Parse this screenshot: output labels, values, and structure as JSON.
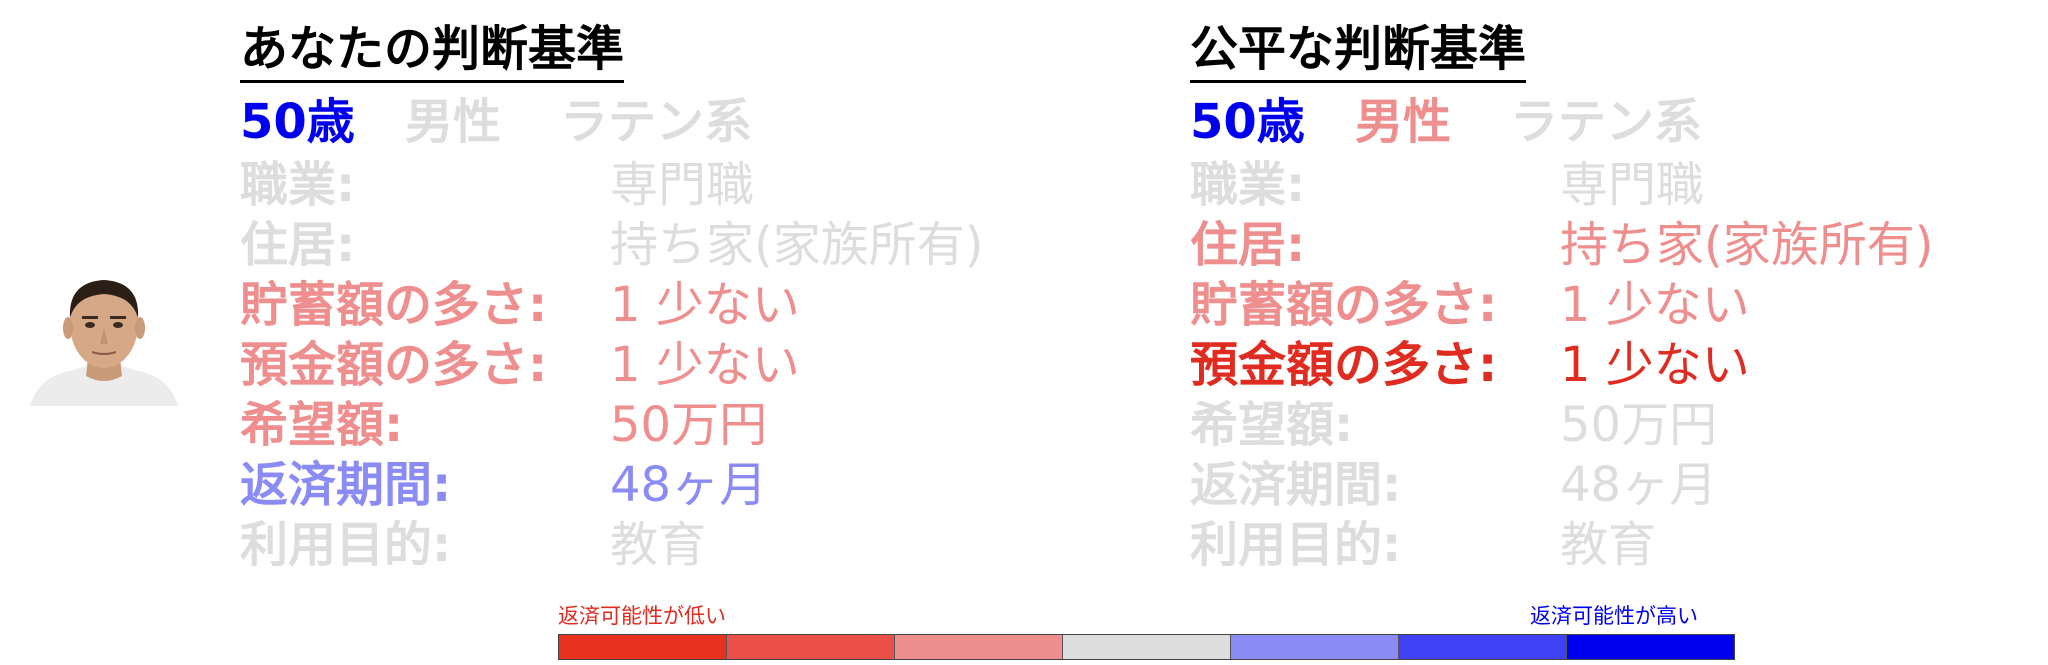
{
  "palette": {
    "neutral": "#dddddd",
    "red_light": "#ee8e8e",
    "red_strong": "#e02b20",
    "blue_light": "#8b8bf5",
    "blue_strong": "#0000ee"
  },
  "left": {
    "title": "あなたの判断基準",
    "age": {
      "text": "50歳",
      "color": "#0000ee"
    },
    "gender": {
      "text": "男性",
      "color": "#dddddd"
    },
    "ethnicity": {
      "text": "ラテン系",
      "color": "#dddddd"
    },
    "rows": [
      {
        "label": "職業:",
        "value": "専門職",
        "color": "#dddddd"
      },
      {
        "label": "住居:",
        "value": "持ち家(家族所有)",
        "color": "#dddddd"
      },
      {
        "label": "貯蓄額の多さ:",
        "value": "1 少ない",
        "color": "#ee8e8e"
      },
      {
        "label": "預金額の多さ:",
        "value": "1 少ない",
        "color": "#ee8e8e"
      },
      {
        "label": "希望額:",
        "value": "50万円",
        "color": "#ee8e8e"
      },
      {
        "label": "返済期間:",
        "value": "48ヶ月",
        "color": "#8b8bf5"
      },
      {
        "label": "利用目的:",
        "value": "教育",
        "color": "#dddddd"
      }
    ]
  },
  "right": {
    "title": "公平な判断基準",
    "age": {
      "text": "50歳",
      "color": "#0000ee"
    },
    "gender": {
      "text": "男性",
      "color": "#ee8e8e"
    },
    "ethnicity": {
      "text": "ラテン系",
      "color": "#dddddd"
    },
    "rows": [
      {
        "label": "職業:",
        "value": "専門職",
        "color": "#dddddd"
      },
      {
        "label": "住居:",
        "value": "持ち家(家族所有)",
        "color": "#ee8e8e"
      },
      {
        "label": "貯蓄額の多さ:",
        "value": "1 少ない",
        "color": "#ee8e8e"
      },
      {
        "label": "預金額の多さ:",
        "value": "1 少ない",
        "color": "#e02b20"
      },
      {
        "label": "希望額:",
        "value": "50万円",
        "color": "#dddddd"
      },
      {
        "label": "返済期間:",
        "value": "48ヶ月",
        "color": "#dddddd"
      },
      {
        "label": "利用目的:",
        "value": "教育",
        "color": "#dddddd"
      }
    ]
  },
  "scale": {
    "low_label": "返済可能性が低い",
    "high_label": "返済可能性が高い",
    "low_color": "#e02b20",
    "high_color": "#0000ee",
    "colors": [
      "#e8321f",
      "#eb5048",
      "#ee8e8e",
      "#dddddd",
      "#8b8bf5",
      "#4040f5",
      "#0000ee"
    ]
  }
}
